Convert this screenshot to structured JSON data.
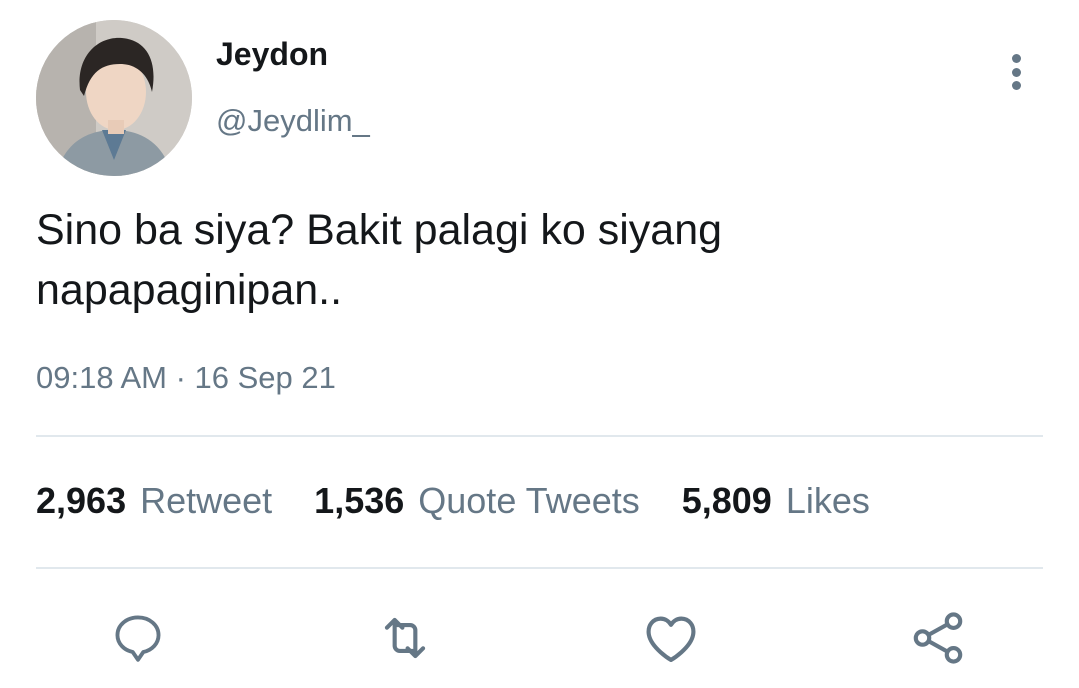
{
  "tweet": {
    "author": {
      "display_name": "Jeydon",
      "handle": "@Jeydlim_"
    },
    "text": "Sino ba siya? Bakit palagi ko siyang napapaginipan..",
    "timestamp": "09:18 AM · 16 Sep 21",
    "stats": [
      {
        "count": "2,963",
        "label": "Retweet"
      },
      {
        "count": "1,536",
        "label": "Quote Tweets"
      },
      {
        "count": "5,809",
        "label": "Likes"
      }
    ]
  },
  "icons": {
    "more": "more-vertical-icon",
    "reply": "reply-icon",
    "retweet": "retweet-icon",
    "like": "heart-icon",
    "share": "share-icon"
  },
  "colors": {
    "text_primary": "#14171a",
    "text_secondary": "#657786",
    "divider": "#e1e8ed"
  }
}
